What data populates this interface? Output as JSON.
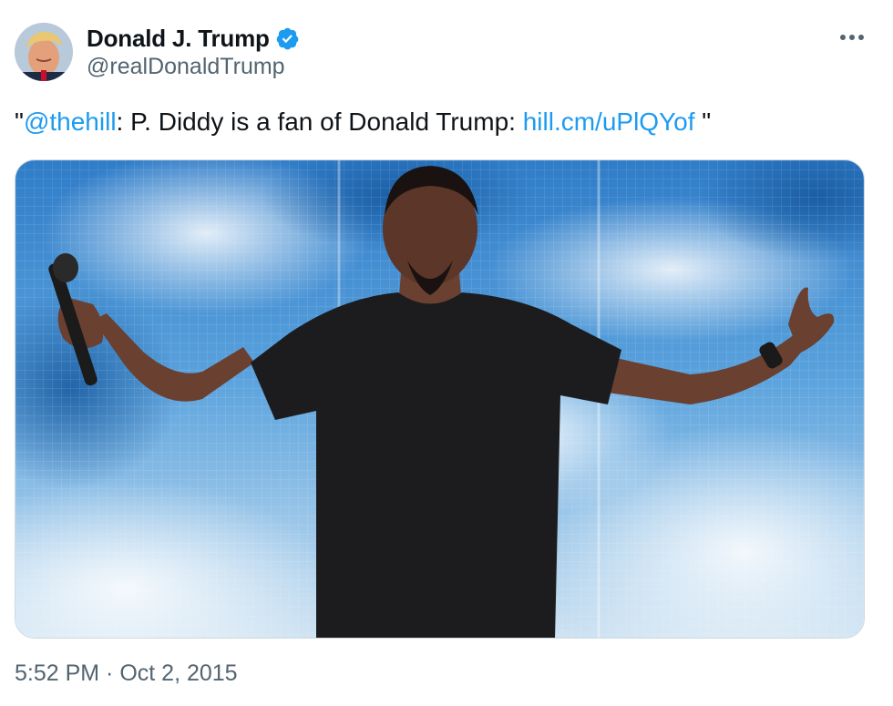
{
  "author": {
    "display_name": "Donald J. Trump",
    "handle": "@realDonaldTrump",
    "verified_icon": "verified-badge-icon",
    "avatar_icon": "avatar-portrait"
  },
  "header": {
    "more_icon": "more-options-icon"
  },
  "tweet": {
    "quote_open": "\"",
    "mention": "@thehill",
    "text_middle": ": P. Diddy is a fan of Donald Trump: ",
    "url": "hill.cm/uPlQYof",
    "quote_close": " \""
  },
  "media": {
    "icon": "photo-performer-on-stage"
  },
  "meta": {
    "time": "5:52 PM",
    "separator": " · ",
    "date": "Oct 2, 2015"
  },
  "colors": {
    "link": "#1d9bf0",
    "verified": "#1d9bf0",
    "secondary_text": "#536471",
    "primary_text": "#0f1419"
  }
}
